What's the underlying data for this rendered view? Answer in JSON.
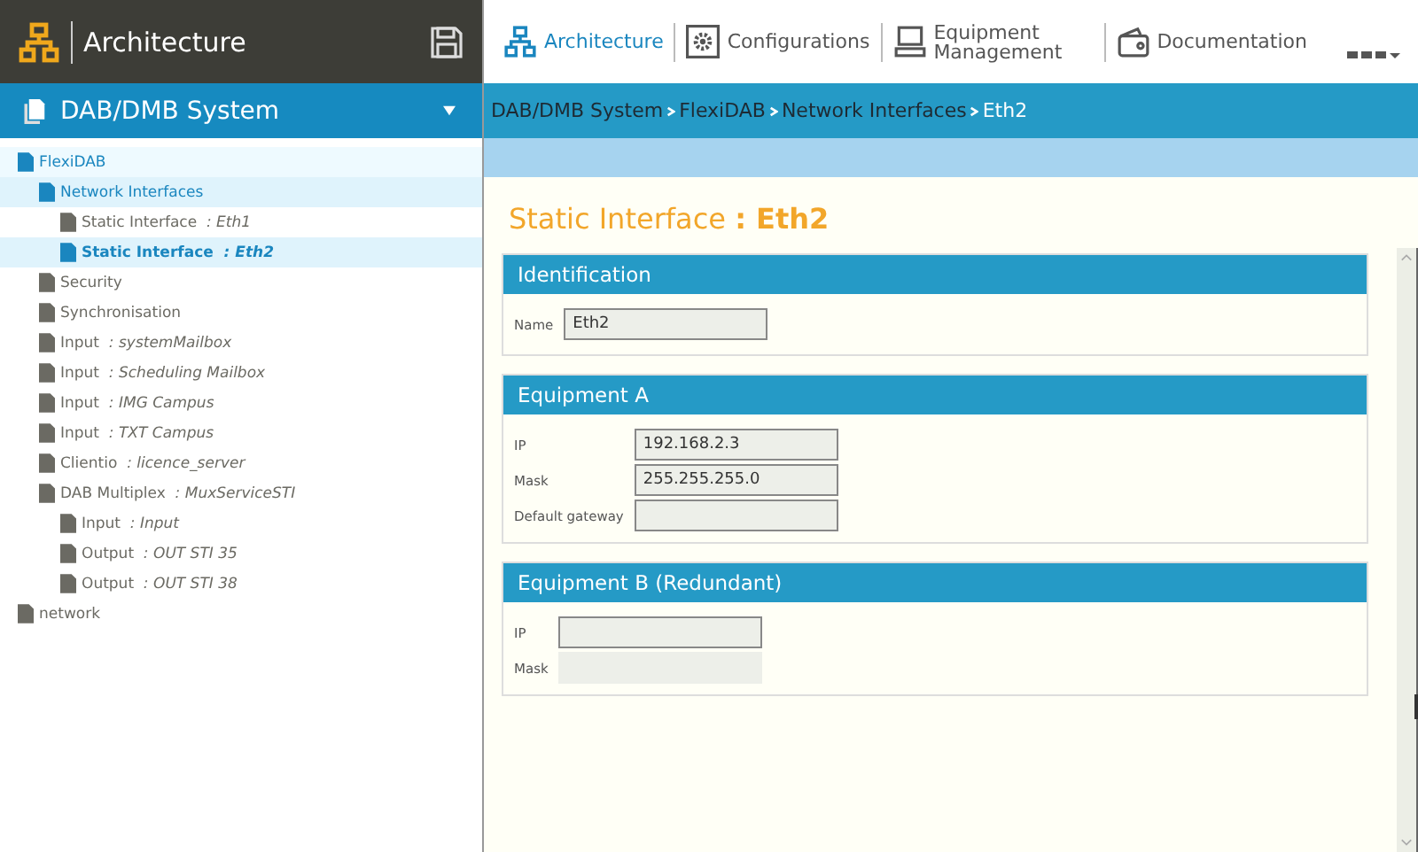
{
  "app": {
    "title": "Architecture"
  },
  "nav": [
    {
      "label": "Architecture",
      "selected": true,
      "kind": "network"
    },
    {
      "label": "Configurations",
      "selected": false,
      "kind": "gear"
    },
    {
      "label": "Equipment Management",
      "selected": false,
      "kind": "computer"
    },
    {
      "label": "Documentation",
      "selected": false,
      "kind": "wallet"
    }
  ],
  "system": {
    "title": "DAB/DMB System"
  },
  "breadcrumb": [
    {
      "label": "DAB/DMB System",
      "selected": false
    },
    {
      "label": "FlexiDAB",
      "selected": false
    },
    {
      "label": "Network Interfaces",
      "selected": false
    },
    {
      "label": "Eth2",
      "selected": true
    }
  ],
  "tree": [
    {
      "label": "FlexiDAB",
      "in_path": true,
      "selected": false,
      "children": [
        {
          "label": "Network Interfaces",
          "in_path": true,
          "selected": false,
          "children": [
            {
              "label": "Static Interface",
              "suffix": ": Eth1",
              "in_path": false,
              "selected": false
            },
            {
              "label": "Static Interface",
              "suffix": ": Eth2",
              "in_path": true,
              "selected": true
            }
          ]
        },
        {
          "label": "Security",
          "in_path": false,
          "selected": false
        },
        {
          "label": "Synchronisation",
          "in_path": false,
          "selected": false
        },
        {
          "label": "Input",
          "suffix": ": systemMailbox",
          "in_path": false,
          "selected": false
        },
        {
          "label": "Input",
          "suffix": ": Scheduling Mailbox",
          "in_path": false,
          "selected": false
        },
        {
          "label": "Input",
          "suffix": ": IMG Campus",
          "in_path": false,
          "selected": false
        },
        {
          "label": "Input",
          "suffix": ": TXT Campus",
          "in_path": false,
          "selected": false
        },
        {
          "label": "Clientio",
          "suffix": ": licence_server",
          "in_path": false,
          "selected": false
        },
        {
          "label": "DAB Multiplex",
          "suffix": ": MuxServiceSTI",
          "in_path": false,
          "selected": false,
          "children": [
            {
              "label": "Input",
              "suffix": ": Input",
              "in_path": false,
              "selected": false
            },
            {
              "label": "Output",
              "suffix": ": OUT STI 35",
              "in_path": false,
              "selected": false
            },
            {
              "label": "Output",
              "suffix": ": OUT STI 38",
              "in_path": false,
              "selected": false
            }
          ]
        }
      ]
    },
    {
      "label": "network",
      "in_path": false,
      "selected": false
    }
  ],
  "page": {
    "title": "Static Interface",
    "subtitle": ": Eth2"
  },
  "sections": [
    {
      "title": "Identification",
      "fields": [
        {
          "label": "Name",
          "value": "Eth2",
          "disabled": false
        }
      ]
    },
    {
      "title": "Equipment A",
      "fields": [
        {
          "label": "IP",
          "value": "192.168.2.3",
          "disabled": false
        },
        {
          "label": "Mask",
          "value": "255.255.255.0",
          "disabled": false
        },
        {
          "label": "Default gateway",
          "disabled": false
        }
      ]
    },
    {
      "title": "Equipment B (Redundant)",
      "fields": [
        {
          "label": "IP",
          "disabled": false
        },
        {
          "label": "Mask",
          "disabled": true
        }
      ]
    }
  ]
}
